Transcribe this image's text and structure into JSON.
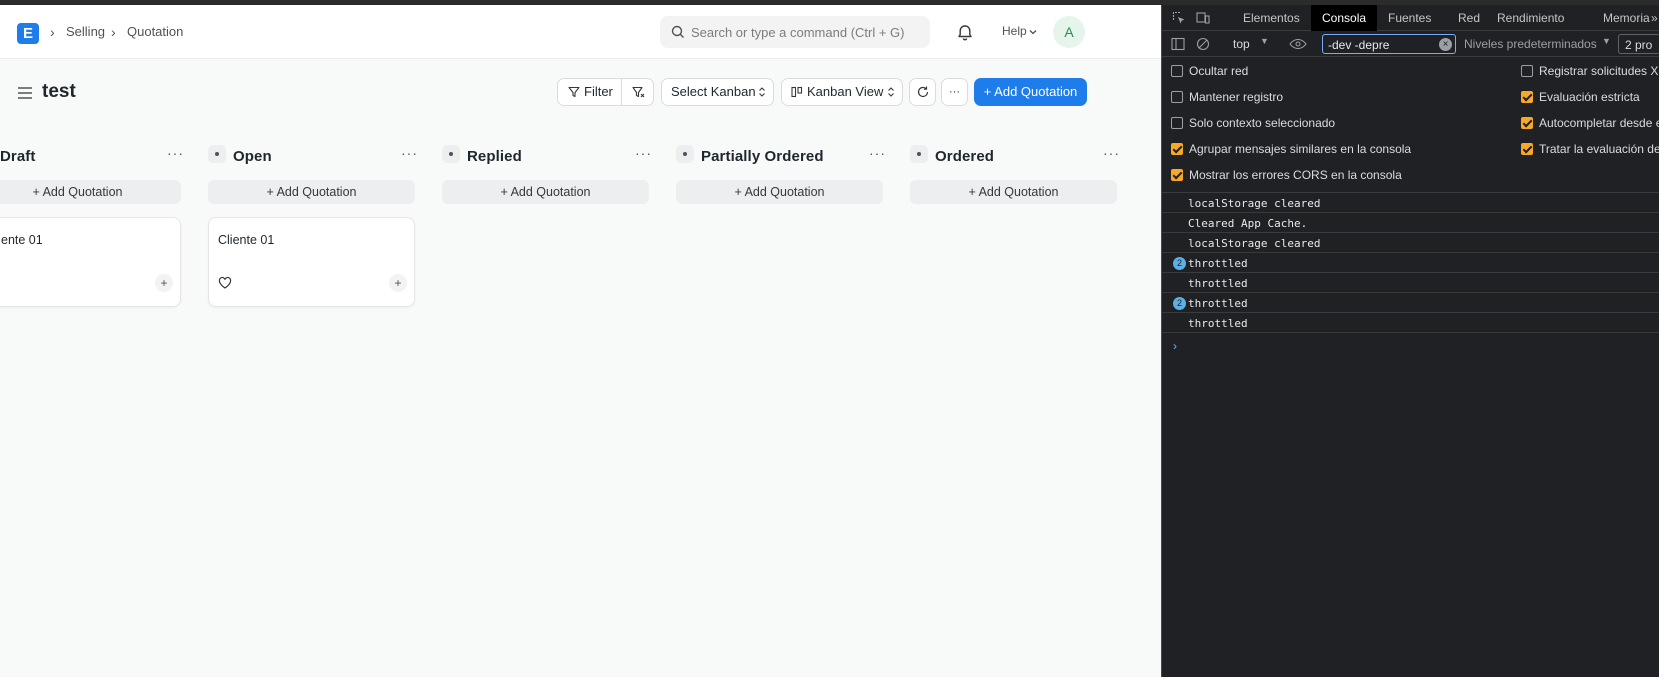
{
  "navbar": {
    "logo_letter": "E",
    "breadcrumbs": [
      "Selling",
      "Quotation"
    ],
    "search_placeholder": "Search or type a command (Ctrl + G)",
    "help_label": "Help",
    "avatar_letter": "A"
  },
  "page": {
    "title": "test",
    "buttons": {
      "filter": "Filter",
      "select_kanban": "Select Kanban",
      "kanban_view": "Kanban View",
      "more": "···",
      "add_quotation": "+ Add Quotation"
    }
  },
  "kanban": {
    "columns": [
      {
        "title": "Draft",
        "add_label": "+ Add Quotation",
        "card": "ente 01"
      },
      {
        "title": "Open",
        "add_label": "+ Add Quotation",
        "card": "Cliente 01"
      },
      {
        "title": "Replied",
        "add_label": "+ Add Quotation"
      },
      {
        "title": "Partially Ordered",
        "add_label": "+ Add Quotation"
      },
      {
        "title": "Ordered",
        "add_label": "+ Add Quotation"
      }
    ],
    "more_label": "···",
    "plus_label": "+"
  },
  "devtools": {
    "tabs": [
      "Elementos",
      "Consola",
      "Fuentes",
      "Red",
      "Rendimiento",
      "Memoria"
    ],
    "active_tab": "Consola",
    "context": "top",
    "filter_value": "-dev -depre",
    "levels": "Niveles predeterminados",
    "issues": "2 pro",
    "options_left": [
      {
        "label": "Ocultar red",
        "checked": false
      },
      {
        "label": "Mantener registro",
        "checked": false
      },
      {
        "label": "Solo contexto seleccionado",
        "checked": false
      },
      {
        "label": "Agrupar mensajes similares en la consola",
        "checked": true
      },
      {
        "label": "Mostrar los errores CORS en la consola",
        "checked": true
      }
    ],
    "options_right": [
      {
        "label": "Registrar solicitudes XM",
        "checked": false
      },
      {
        "label": "Evaluación estricta",
        "checked": true
      },
      {
        "label": "Autocompletar desde e",
        "checked": true
      },
      {
        "label": "Tratar la evaluación del",
        "checked": true
      }
    ],
    "logs": [
      {
        "text": "localStorage cleared",
        "count": ""
      },
      {
        "text": "Cleared App Cache.",
        "count": ""
      },
      {
        "text": "localStorage cleared",
        "count": ""
      },
      {
        "text": "throttled",
        "count": "2"
      },
      {
        "text": "throttled",
        "count": ""
      },
      {
        "text": "throttled",
        "count": "2"
      },
      {
        "text": "throttled",
        "count": ""
      }
    ],
    "prompt": "›"
  },
  "colors": {
    "primary": "#1f7ceb",
    "devtools_bg": "#202124",
    "checkbox_on": "#f9a825"
  }
}
